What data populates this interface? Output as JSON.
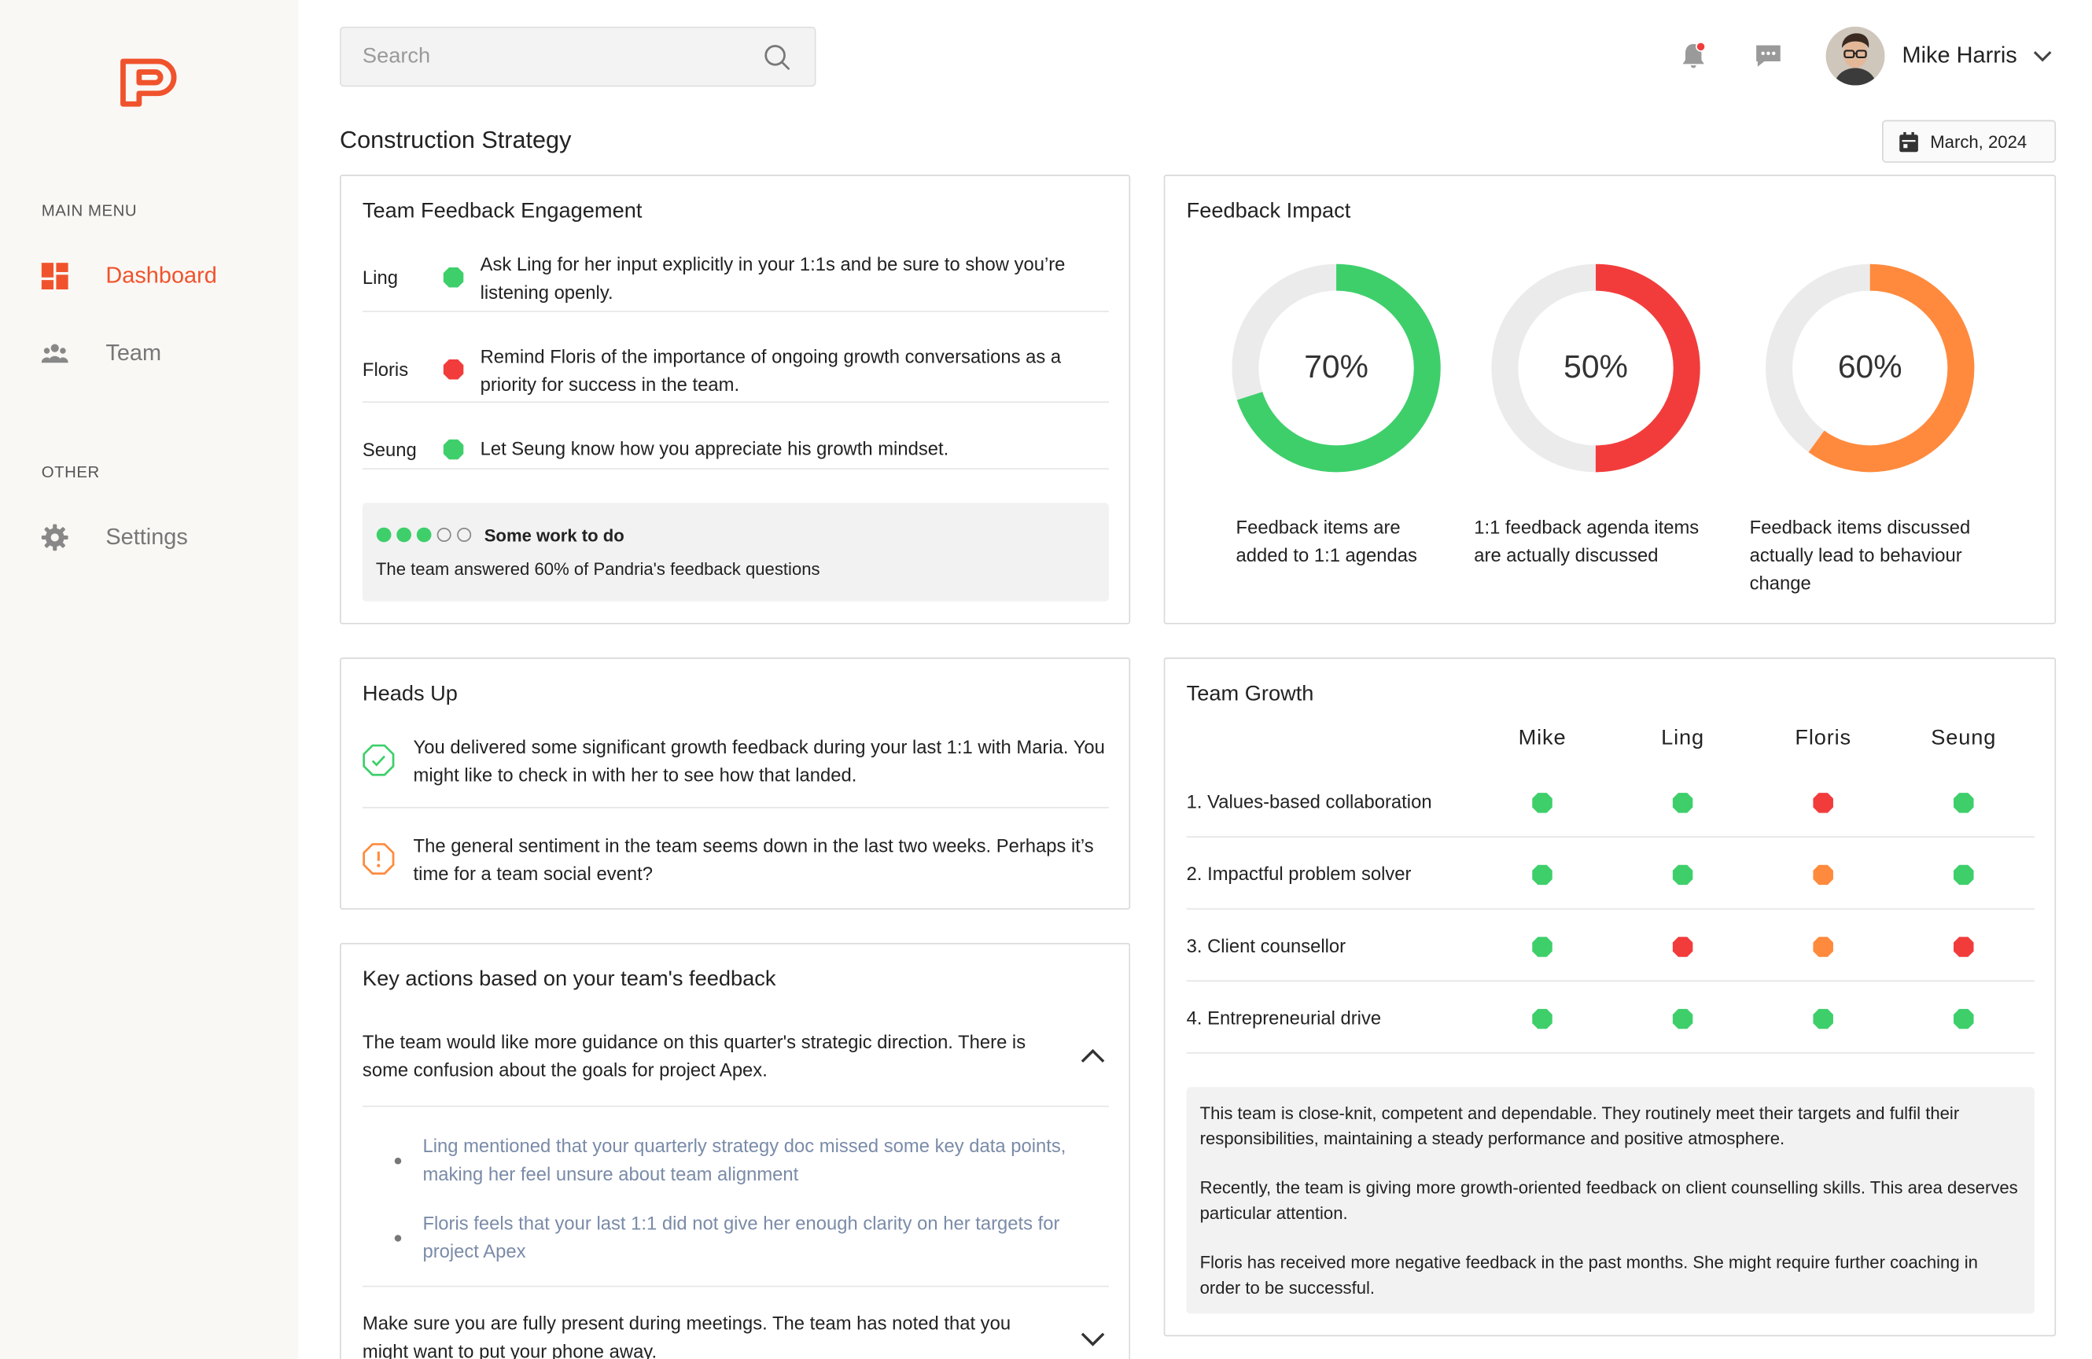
{
  "search": {
    "placeholder": "Search"
  },
  "sidebar": {
    "main_menu_heading": "MAIN MENU",
    "other_heading": "OTHER",
    "items": [
      {
        "label": "Dashboard",
        "icon": "dashboard-icon",
        "active": true
      },
      {
        "label": "Team",
        "icon": "team-icon",
        "active": false
      },
      {
        "label": "Settings",
        "icon": "gear-icon",
        "active": false
      }
    ]
  },
  "user": {
    "name": "Mike Harris"
  },
  "page": {
    "title": "Construction Strategy",
    "date": "March, 2024"
  },
  "engagement": {
    "title": "Team Feedback Engagement",
    "rows": [
      {
        "name": "Ling",
        "status": "green",
        "text": "Ask Ling for her input explicitly in your 1:1s and be sure to show you’re listening openly."
      },
      {
        "name": "Floris",
        "status": "red",
        "text": "Remind Floris of the importance of ongoing growth conversations as a priority for success in the team."
      },
      {
        "name": "Seung",
        "status": "green",
        "text": "Let Seung know how you appreciate his growth mindset."
      }
    ],
    "summary": {
      "filled": 3,
      "total": 5,
      "status": "Some work to do",
      "text": "The team answered 60% of Pandria's feedback questions"
    }
  },
  "impact": {
    "title": "Feedback Impact",
    "donuts": [
      {
        "value": 70,
        "label": "70%",
        "color": "#3ecf6b",
        "caption": [
          "Feedback items are",
          "added to 1:1 agendas"
        ]
      },
      {
        "value": 50,
        "label": "50%",
        "color": "#f23c3c",
        "caption": [
          "1:1 feedback agenda items",
          "are actually discussed"
        ]
      },
      {
        "value": 60,
        "label": "60%",
        "color": "#ff8a3d",
        "caption": [
          "Feedback items  discussed",
          "actually lead to behaviour",
          "change"
        ]
      }
    ]
  },
  "heads_up": {
    "title": "Heads Up",
    "items": [
      {
        "type": "success",
        "text": "You delivered some significant growth feedback during your last 1:1 with Maria. You might like to check in with her to see how that landed."
      },
      {
        "type": "warning",
        "text": "The general sentiment in the team seems down in the last two weeks. Perhaps it’s time for a team social event?"
      }
    ]
  },
  "key_actions": {
    "title": "Key actions based on your team's feedback",
    "items": [
      {
        "text": "The team would like more guidance on this quarter's strategic direction. There is some confusion about the goals for project Apex.",
        "expanded": true,
        "details": [
          "Ling mentioned that your quarterly strategy doc missed some key data points, making her feel unsure about team alignment",
          "Floris feels that your last 1:1 did not give her enough clarity on her targets for project Apex"
        ]
      },
      {
        "text": "Make sure you are fully present during meetings. The team has noted that you might want to put your phone away.",
        "expanded": false,
        "details": []
      }
    ]
  },
  "team_growth": {
    "title": "Team Growth",
    "members": [
      "Mike",
      "Ling",
      "Floris",
      "Seung"
    ],
    "rows": [
      {
        "label": "1. Values-based collaboration",
        "statuses": [
          "green",
          "green",
          "red",
          "green"
        ]
      },
      {
        "label": "2. Impactful problem solver",
        "statuses": [
          "green",
          "green",
          "orange",
          "green"
        ]
      },
      {
        "label": "3. Client counsellor",
        "statuses": [
          "green",
          "red",
          "orange",
          "red"
        ]
      },
      {
        "label": "4. Entrepreneurial drive",
        "statuses": [
          "green",
          "green",
          "green",
          "green"
        ]
      }
    ],
    "summary": [
      "This team is close-knit, competent and dependable. They routinely meet their targets and fulfil their responsibilities, maintaining a steady  performance and positive atmosphere.",
      "Recently, the team is giving more growth-oriented feedback on  client counselling skills. This area deserves particular attention.",
      "Floris has received more negative feedback in the past months. She might require further coaching in order to be successful."
    ]
  },
  "colors": {
    "accent": "#f0532c",
    "green": "#3ecf6b",
    "red": "#f23c3c",
    "orange": "#ff8a3d",
    "track": "#ebebeb"
  }
}
